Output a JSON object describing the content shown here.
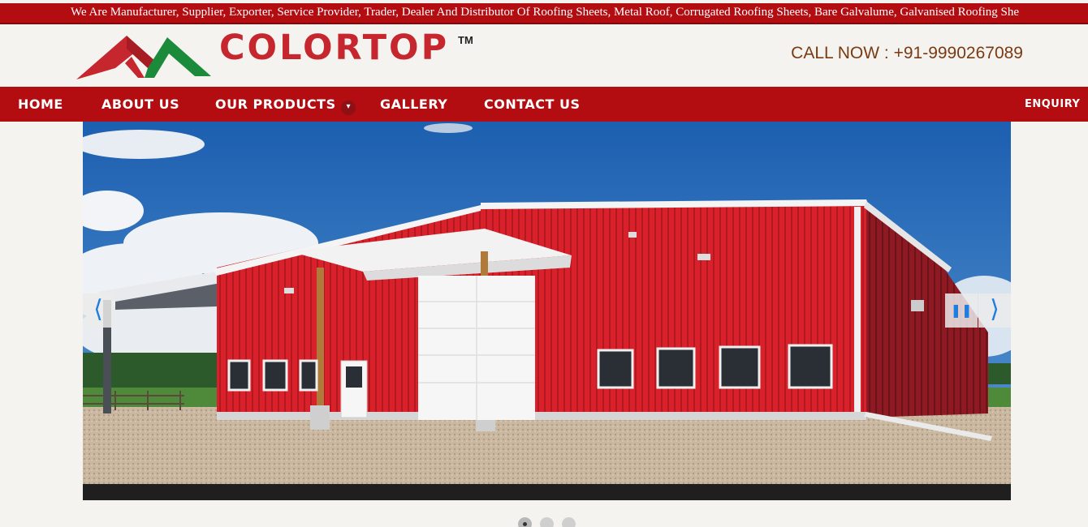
{
  "topstrip": {
    "marquee": "We Are Manufacturer, Supplier, Exporter, Service Provider, Trader, Dealer And Distributor Of Roofing Sheets, Metal Roof, Corrugated Roofing Sheets, Bare Galvalume, Galvanised Roofing She"
  },
  "header": {
    "logo_text": "COLORTOP",
    "logo_tm": "TM",
    "call_now": "CALL NOW : +91-9990267089"
  },
  "nav": {
    "items": [
      {
        "label": "HOME"
      },
      {
        "label": "ABOUT US"
      },
      {
        "label": "OUR PRODUCTS"
      },
      {
        "label": "GALLERY"
      },
      {
        "label": "CONTACT US"
      }
    ],
    "enquiry": "ENQUIRY",
    "dropdown_icon": "chevron-down-icon"
  },
  "slider": {
    "slides_count": 3,
    "active_slide": 1,
    "prev_icon": "chevron-left-icon",
    "next_icon": "chevron-right-icon",
    "pause_icon": "pause-icon"
  },
  "colors": {
    "brand_red": "#b30d12",
    "logo_red": "#c6262d",
    "logo_green": "#1c8a3b",
    "call_text": "#7a3b12"
  }
}
